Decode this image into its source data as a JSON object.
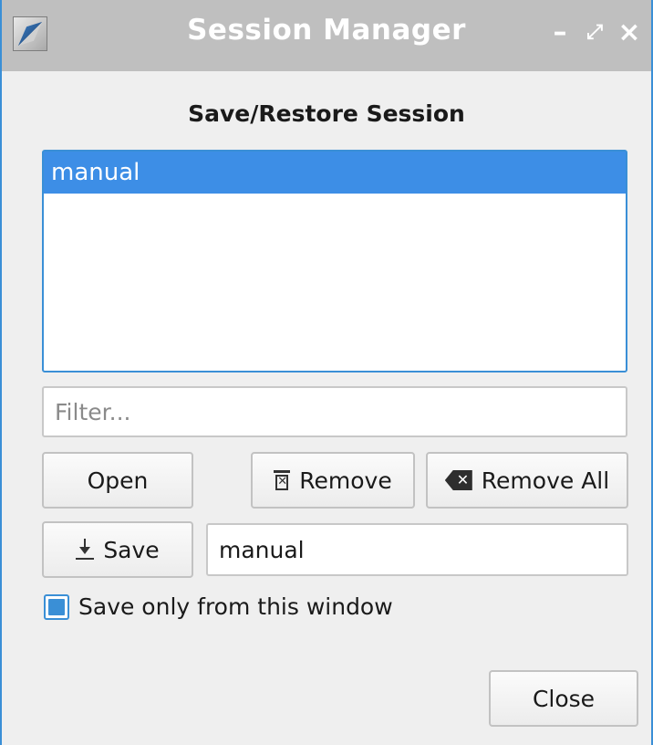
{
  "window": {
    "title": "Session Manager",
    "controls": {
      "minimize": "–",
      "maximize": "⤢",
      "close": "×"
    }
  },
  "dialog": {
    "heading": "Save/Restore Session",
    "sessions": [
      {
        "name": "manual",
        "selected": true
      }
    ],
    "filter": {
      "placeholder": "Filter...",
      "value": ""
    },
    "buttons": {
      "open": "Open",
      "remove": "Remove",
      "remove_all": "Remove All",
      "save": "Save",
      "close": "Close"
    },
    "session_name": {
      "value": "manual"
    },
    "save_only_window": {
      "label": "Save only from this window",
      "checked": true
    }
  },
  "colors": {
    "accent": "#3a8fd6",
    "selection": "#3d8ee6",
    "titlebar": "#bfbfbf"
  },
  "icons": {
    "app": "session-manager-app-icon",
    "remove": "trash-icon",
    "remove_all": "backspace-icon",
    "save": "download-icon",
    "clear": "clear-backspace-icon"
  }
}
